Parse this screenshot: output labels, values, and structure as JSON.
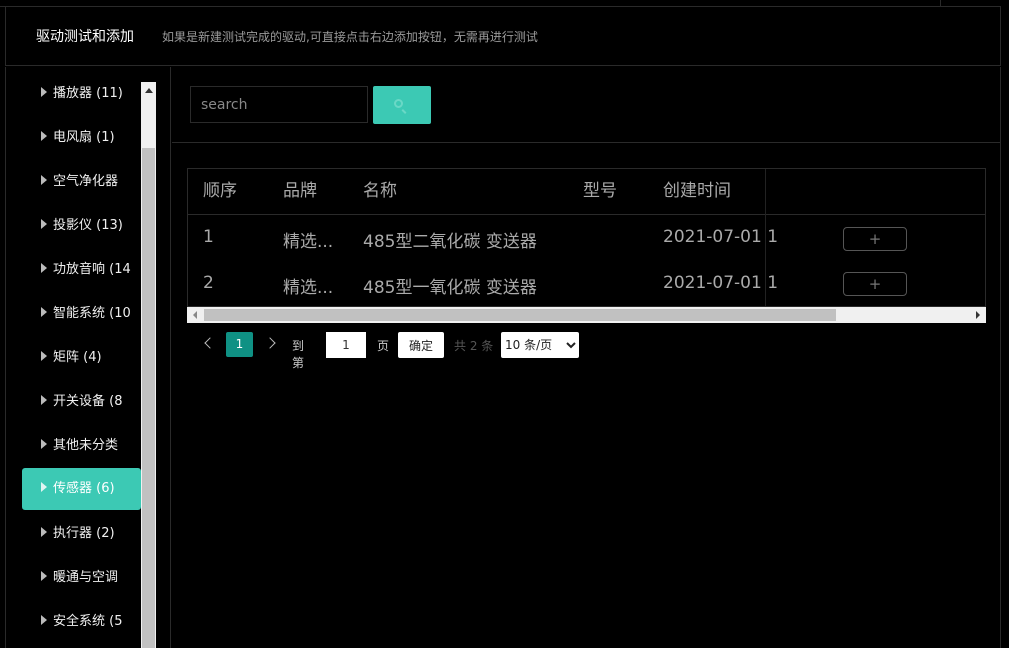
{
  "header": {
    "title": "驱动测试和添加",
    "description": "如果是新建测试完成的驱动,可直接点击右边添加按钮，无需再进行测试"
  },
  "sidebar": {
    "items": [
      {
        "label": "播放器 (11)"
      },
      {
        "label": "电风扇 (1)"
      },
      {
        "label": "空气净化器"
      },
      {
        "label": "投影仪 (13)"
      },
      {
        "label": "功放音响 (14"
      },
      {
        "label": "智能系统 (10"
      },
      {
        "label": "矩阵 (4)"
      },
      {
        "label": "开关设备 (8"
      },
      {
        "label": "其他未分类"
      },
      {
        "label": "传感器 (6)",
        "active": true
      },
      {
        "label": "执行器 (2)"
      },
      {
        "label": "暖通与空调"
      },
      {
        "label": "安全系统 (5"
      }
    ]
  },
  "search": {
    "placeholder": "search"
  },
  "table": {
    "columns": [
      "顺序",
      "品牌",
      "名称",
      "型号",
      "创建时间"
    ],
    "rows": [
      {
        "index": "1",
        "brand": "精选...",
        "name": "485型二氧化碳 变送器",
        "model": "",
        "created": "2021-07-01 1",
        "action": "+"
      },
      {
        "index": "2",
        "brand": "精选...",
        "name": "485型一氧化碳 变送器",
        "model": "",
        "created": "2021-07-01 1",
        "action": "+"
      }
    ]
  },
  "pagination": {
    "current": "1",
    "goto_label": "到第",
    "goto_value": "1",
    "page_unit": "页",
    "confirm": "确定",
    "total": "共 2 条",
    "page_size": "10 条/页"
  },
  "colors": {
    "accent": "#3cc9b4",
    "pager_active": "#0f9184"
  }
}
